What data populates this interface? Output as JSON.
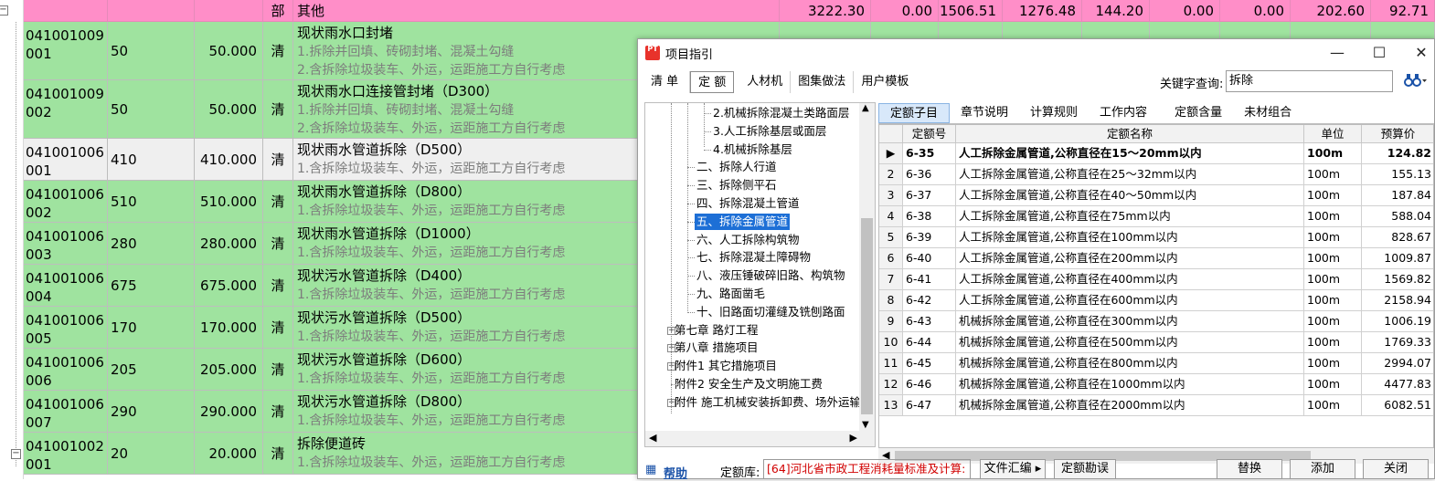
{
  "sheet": {
    "header_row": {
      "expander": "⊟",
      "unit": "部",
      "desc": "其他",
      "n1": "3222.30",
      "n2": "0.00",
      "n3": "1506.51",
      "n4": "1276.48",
      "n5": "144.20",
      "n6": "0.00",
      "n7": "0.00",
      "n8": "202.60",
      "n9": "92.71"
    },
    "rows": [
      {
        "code": "041001009001",
        "qty": "50",
        "amount": "50.000",
        "unit": "清",
        "title": "现状雨水口封堵",
        "lines": [
          "1.拆除并回填、砖砌封堵、混凝土勾缝",
          "2.含拆除垃圾装车、外运，运距施工方自行考虑"
        ]
      },
      {
        "code": "041001009002",
        "qty": "50",
        "amount": "50.000",
        "unit": "清",
        "title": "现状雨水口连接管封堵（D300）",
        "lines": [
          "1.拆除并回填、砖砌封堵、混凝土勾缝",
          "2.含拆除垃圾装车、外运，运距施工方自行考虑"
        ]
      },
      {
        "code": "041001006001",
        "qty": "410",
        "amount": "410.000",
        "unit": "清",
        "title": "现状雨水管道拆除（D500）",
        "lines": [
          "1.含拆除垃圾装车、外运，运距施工方自行考虑"
        ]
      },
      {
        "code": "041001006002",
        "qty": "510",
        "amount": "510.000",
        "unit": "清",
        "title": "现状雨水管道拆除（D800）",
        "lines": [
          "1.含拆除垃圾装车、外运，运距施工方自行考虑"
        ]
      },
      {
        "code": "041001006003",
        "qty": "280",
        "amount": "280.000",
        "unit": "清",
        "title": "现状雨水管道拆除（D1000）",
        "lines": [
          "1.含拆除垃圾装车、外运，运距施工方自行考虑"
        ]
      },
      {
        "code": "041001006004",
        "qty": "675",
        "amount": "675.000",
        "unit": "清",
        "title": "现状污水管道拆除（D400）",
        "lines": [
          "1.含拆除垃圾装车、外运，运距施工方自行考虑"
        ]
      },
      {
        "code": "041001006005",
        "qty": "170",
        "amount": "170.000",
        "unit": "清",
        "title": "现状污水管道拆除（D500）",
        "lines": [
          "1.含拆除垃圾装车、外运，运距施工方自行考虑"
        ]
      },
      {
        "code": "041001006006",
        "qty": "205",
        "amount": "205.000",
        "unit": "清",
        "title": "现状污水管道拆除（D600）",
        "lines": [
          "1.含拆除垃圾装车、外运，运距施工方自行考虑"
        ]
      },
      {
        "code": "041001006007",
        "qty": "290",
        "amount": "290.000",
        "unit": "清",
        "title": "现状污水管道拆除（D800）",
        "lines": [
          "1.含拆除垃圾装车、外运，运距施工方自行考虑"
        ]
      },
      {
        "code": "041001002001",
        "qty": "20",
        "amount": "20.000",
        "unit": "清",
        "title": "拆除便道砖",
        "lines": [
          "1.含拆除垃圾装车、外运，运距施工方自行考虑"
        ]
      }
    ]
  },
  "dialog": {
    "title": "项目指引",
    "app_icon": "PT",
    "window_buttons": {
      "minimize": "—",
      "maximize": "☐",
      "close": "✕"
    },
    "tabs": [
      "清 单",
      "定 额",
      "人材机",
      "图集做法",
      "用户模板"
    ],
    "active_tab": "定 额",
    "keyword_label": "关键字查询:",
    "keyword_value": "拆除",
    "binoculars": "▲",
    "tree": [
      {
        "label": "2.机械拆除混凝土类路面层",
        "level": 3
      },
      {
        "label": "3.人工拆除基层或面层",
        "level": 3
      },
      {
        "label": "4.机械拆除基层",
        "level": 3
      },
      {
        "label": "二、拆除人行道",
        "level": 2
      },
      {
        "label": "三、拆除侧平石",
        "level": 2
      },
      {
        "label": "四、拆除混凝土管道",
        "level": 2
      },
      {
        "label": "五、拆除金属管道",
        "level": 2,
        "selected": true
      },
      {
        "label": "六、人工拆除构筑物",
        "level": 2
      },
      {
        "label": "七、拆除混凝土障碍物",
        "level": 2
      },
      {
        "label": "八、液压锤破碎旧路、构筑物",
        "level": 2
      },
      {
        "label": "九、路面凿毛",
        "level": 2
      },
      {
        "label": "十、旧路面切灌缝及铣刨路面",
        "level": 2
      },
      {
        "label": "第七章 路灯工程",
        "level": 1,
        "plus": true
      },
      {
        "label": "第八章 措施项目",
        "level": 1,
        "plus": true
      },
      {
        "label": "附件1 其它措施项目",
        "level": 1,
        "plus": true
      },
      {
        "label": "附件2 安全生产及文明施工费",
        "level": 1,
        "plus": false
      },
      {
        "label": "附件 施工机械安装拆卸费、场外运输",
        "level": 1,
        "plus": true
      }
    ],
    "subtabs": [
      "定额子目",
      "章节说明",
      "计算规则",
      "工作内容",
      "定额含量",
      "未材组合"
    ],
    "grid_headers": {
      "code": "定额号",
      "name": "定额名称",
      "unit": "单位",
      "price": "预算价"
    },
    "grid_rows": [
      {
        "idx": "▶",
        "code": "6-35",
        "name": "人工拆除金属管道,公称直径在15～20mm以内",
        "unit": "100m",
        "price": "124.82",
        "bold": true
      },
      {
        "idx": "2",
        "code": "6-36",
        "name": "人工拆除金属管道,公称直径在25～32mm以内",
        "unit": "100m",
        "price": "155.13"
      },
      {
        "idx": "3",
        "code": "6-37",
        "name": "人工拆除金属管道,公称直径在40～50mm以内",
        "unit": "100m",
        "price": "187.84"
      },
      {
        "idx": "4",
        "code": "6-38",
        "name": "人工拆除金属管道,公称直径在75mm以内",
        "unit": "100m",
        "price": "588.04"
      },
      {
        "idx": "5",
        "code": "6-39",
        "name": "人工拆除金属管道,公称直径在100mm以内",
        "unit": "100m",
        "price": "828.67"
      },
      {
        "idx": "6",
        "code": "6-40",
        "name": "人工拆除金属管道,公称直径在200mm以内",
        "unit": "100m",
        "price": "1009.87"
      },
      {
        "idx": "7",
        "code": "6-41",
        "name": "人工拆除金属管道,公称直径在400mm以内",
        "unit": "100m",
        "price": "1569.82"
      },
      {
        "idx": "8",
        "code": "6-42",
        "name": "人工拆除金属管道,公称直径在600mm以内",
        "unit": "100m",
        "price": "2158.94"
      },
      {
        "idx": "9",
        "code": "6-43",
        "name": "机械拆除金属管道,公称直径在300mm以内",
        "unit": "100m",
        "price": "1006.19"
      },
      {
        "idx": "10",
        "code": "6-44",
        "name": "机械拆除金属管道,公称直径在500mm以内",
        "unit": "100m",
        "price": "1769.33"
      },
      {
        "idx": "11",
        "code": "6-45",
        "name": "机械拆除金属管道,公称直径在800mm以内",
        "unit": "100m",
        "price": "2994.07"
      },
      {
        "idx": "12",
        "code": "6-46",
        "name": "机械拆除金属管道,公称直径在1000mm以内",
        "unit": "100m",
        "price": "4477.83"
      },
      {
        "idx": "13",
        "code": "6-47",
        "name": "机械拆除金属管道,公称直径在2000mm以内",
        "unit": "100m",
        "price": "6082.51"
      }
    ],
    "bottom": {
      "help": "帮助",
      "lib_label": "定额库:",
      "lib_value": "[64]河北省市政工程消耗量标准及计算:",
      "file_btn": "文件汇编 ▸",
      "errata_btn": "定额勘误",
      "replace_btn": "替换",
      "add_btn": "添加",
      "close_btn": "关闭"
    }
  }
}
